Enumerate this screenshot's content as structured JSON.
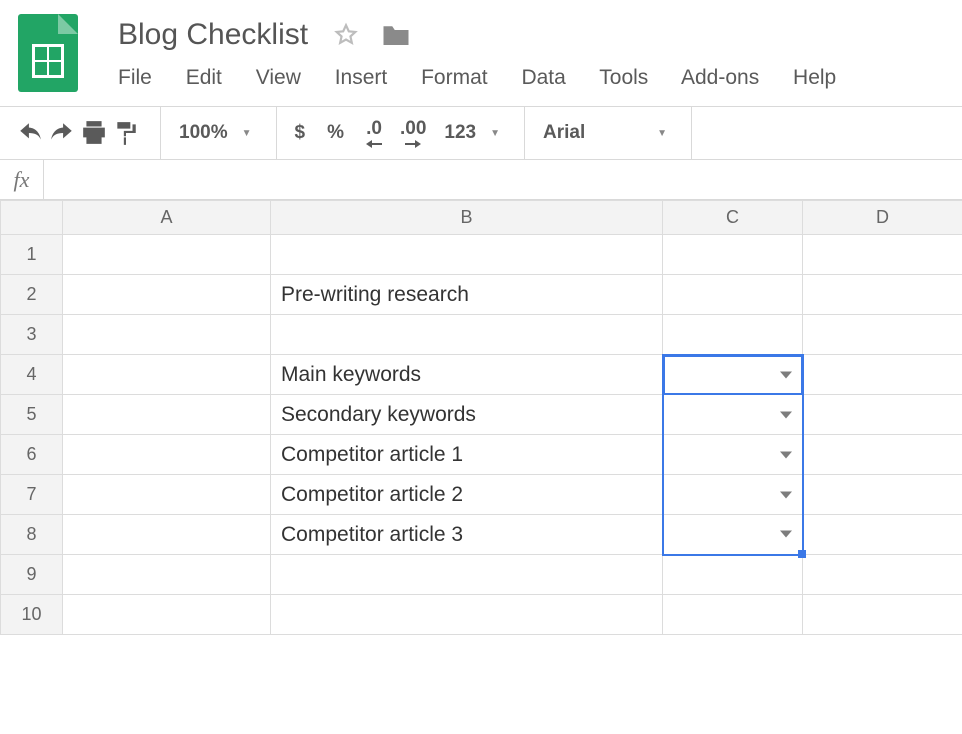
{
  "doc": {
    "title": "Blog Checklist"
  },
  "menu": [
    "File",
    "Edit",
    "View",
    "Insert",
    "Format",
    "Data",
    "Tools",
    "Add-ons",
    "Help"
  ],
  "toolbar": {
    "zoom": "100%",
    "currency": "$",
    "percent": "%",
    "dec_dec": ".0",
    "dec_inc": ".00",
    "numfmt": "123",
    "font": "Arial"
  },
  "formula_bar": {
    "label": "fx",
    "value": ""
  },
  "columns": [
    "A",
    "B",
    "C",
    "D"
  ],
  "rows": [
    "1",
    "2",
    "3",
    "4",
    "5",
    "6",
    "7",
    "8",
    "9",
    "10"
  ],
  "cells": {
    "B2": "Pre-writing research",
    "B4": "Main keywords",
    "B5": "Secondary keywords",
    "B6": "Competitor article 1",
    "B7": "Competitor article 2",
    "B8": "Competitor article 3"
  },
  "selection": {
    "range": "C4:C8",
    "active": "C4"
  },
  "icons": {
    "star": "star-outline-icon",
    "folder": "folder-icon",
    "undo": "undo-icon",
    "redo": "redo-icon",
    "print": "print-icon",
    "paint": "paint-format-icon"
  }
}
